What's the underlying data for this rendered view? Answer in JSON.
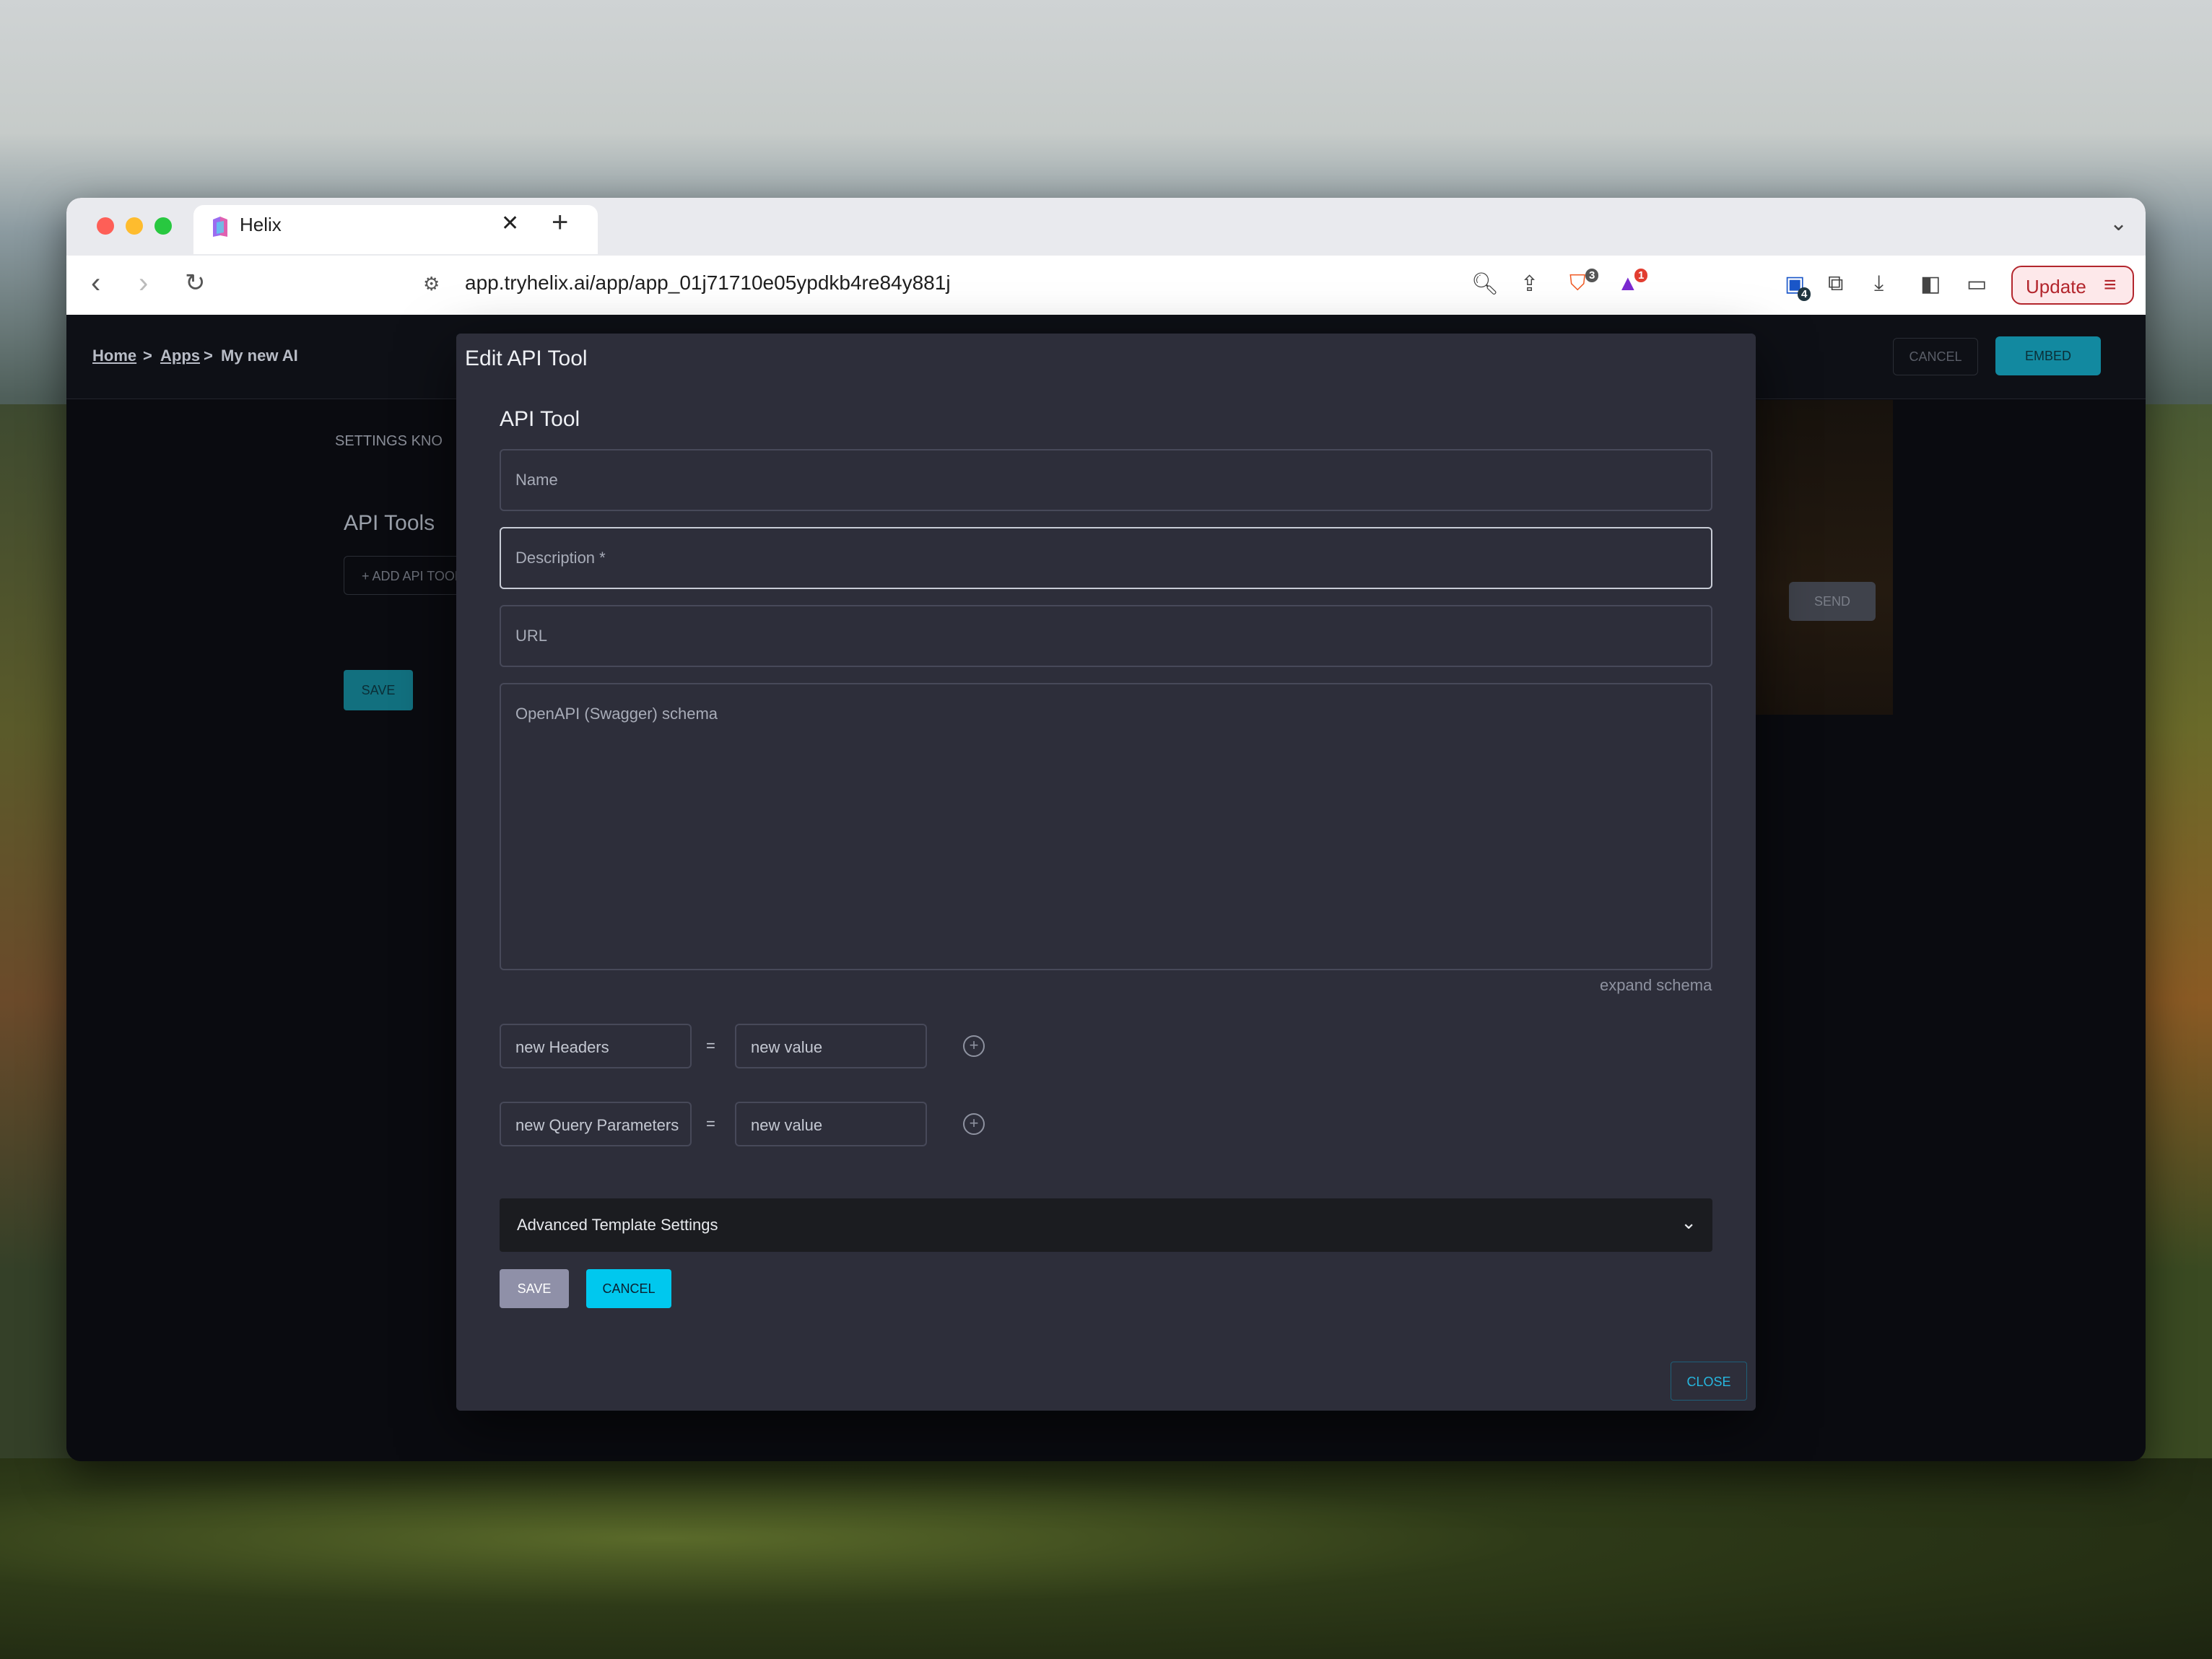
{
  "browser": {
    "tab_title": "Helix",
    "tab_close": "✕",
    "new_tab": "+",
    "url": "app.tryhelix.ai/app/app_01j71710e05ypdkb4re84y881j",
    "brave_badge": "3",
    "rewards_badge": "1",
    "extensions_badge": "4",
    "update_label": "Update"
  },
  "app": {
    "breadcrumb": {
      "home": "Home",
      "apps": "Apps",
      "current": "My new AI",
      "separator": ">"
    },
    "header": {
      "cancel_label": "CANCEL",
      "embed_label": "EMBED"
    },
    "tabs": "SETTINGS    KNO",
    "section_heading": "API Tools",
    "add_tool_label": "+ ADD API TOOL",
    "save_label": "SAVE",
    "send_label": "SEND"
  },
  "modal": {
    "title": "Edit API Tool",
    "section_title": "API Tool",
    "fields": {
      "name_placeholder": "Name",
      "description_placeholder": "Description *",
      "url_placeholder": "URL",
      "schema_placeholder": "OpenAPI (Swagger) schema"
    },
    "expand_schema_label": "expand schema",
    "headers": {
      "key_placeholder": "new Headers",
      "value_placeholder": "new value",
      "equals": "="
    },
    "query_params": {
      "key_placeholder": "new Query Parameters",
      "value_placeholder": "new value",
      "equals": "="
    },
    "advanced_label": "Advanced Template Settings",
    "save_label": "SAVE",
    "cancel_label": "CANCEL",
    "close_label": "CLOSE"
  },
  "colors": {
    "accent_cyan": "#00c8ee",
    "modal_bg": "#2d2e3a",
    "embed_teal": "#1289a0",
    "update_red": "#b3262d"
  }
}
